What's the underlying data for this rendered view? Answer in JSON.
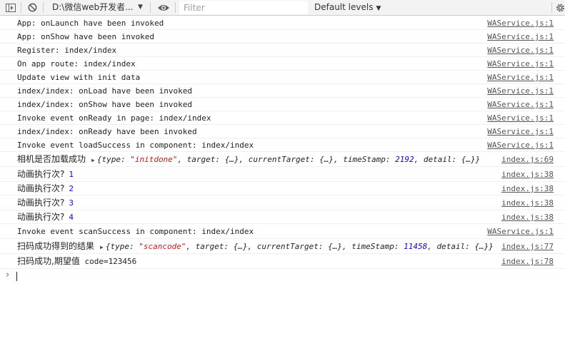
{
  "toolbar": {
    "context": "D:\\微信web开发者...",
    "filter_placeholder": "Filter",
    "levels": "Default levels"
  },
  "console": [
    {
      "msg": "App: onLaunch have been invoked",
      "src": "WAService.js:1"
    },
    {
      "msg": "App: onShow have been invoked",
      "src": "WAService.js:1"
    },
    {
      "msg": "Register: index/index",
      "src": "WAService.js:1"
    },
    {
      "msg": "On app route: index/index",
      "src": "WAService.js:1"
    },
    {
      "msg": "Update view with init data",
      "src": "WAService.js:1"
    },
    {
      "msg": "index/index: onLoad have been invoked",
      "src": "WAService.js:1"
    },
    {
      "msg": "index/index: onShow have been invoked",
      "src": "WAService.js:1"
    },
    {
      "msg": "Invoke event onReady in page: index/index",
      "src": "WAService.js:1"
    },
    {
      "msg": "index/index: onReady have been invoked",
      "src": "WAService.js:1"
    },
    {
      "msg": "Invoke event loadSuccess in component: index/index",
      "src": "WAService.js:1"
    },
    {
      "msg": "相机是否加载成功",
      "obj": {
        "type_key": "{type: ",
        "type_val": "\"initdone\"",
        "rest1": ", target: {…}, currentTarget: {…}, timeStamp: ",
        "ts": "2192",
        "rest2": ", detail: {…}}"
      },
      "src": "index.js:69"
    },
    {
      "msg": "动画执行次?",
      "num": "1",
      "src": "index.js:38"
    },
    {
      "msg": "动画执行次?",
      "num": "2",
      "src": "index.js:38"
    },
    {
      "msg": "动画执行次?",
      "num": "3",
      "src": "index.js:38"
    },
    {
      "msg": "动画执行次?",
      "num": "4",
      "src": "index.js:38"
    },
    {
      "msg": "Invoke event scanSuccess in component: index/index",
      "src": "WAService.js:1"
    },
    {
      "msg": "扫码成功得到的结果",
      "obj": {
        "type_key": "{type: ",
        "type_val": "\"scancode\"",
        "rest1": ", target: {…}, currentTarget: {…}, timeStamp: ",
        "ts": "11458",
        "rest2": ", detail: {…}}"
      },
      "src": "index.js:77"
    },
    {
      "msg": "扫码成功,期望值",
      "tail": " code=123456",
      "src": "index.js:78"
    }
  ],
  "prompt": "›"
}
